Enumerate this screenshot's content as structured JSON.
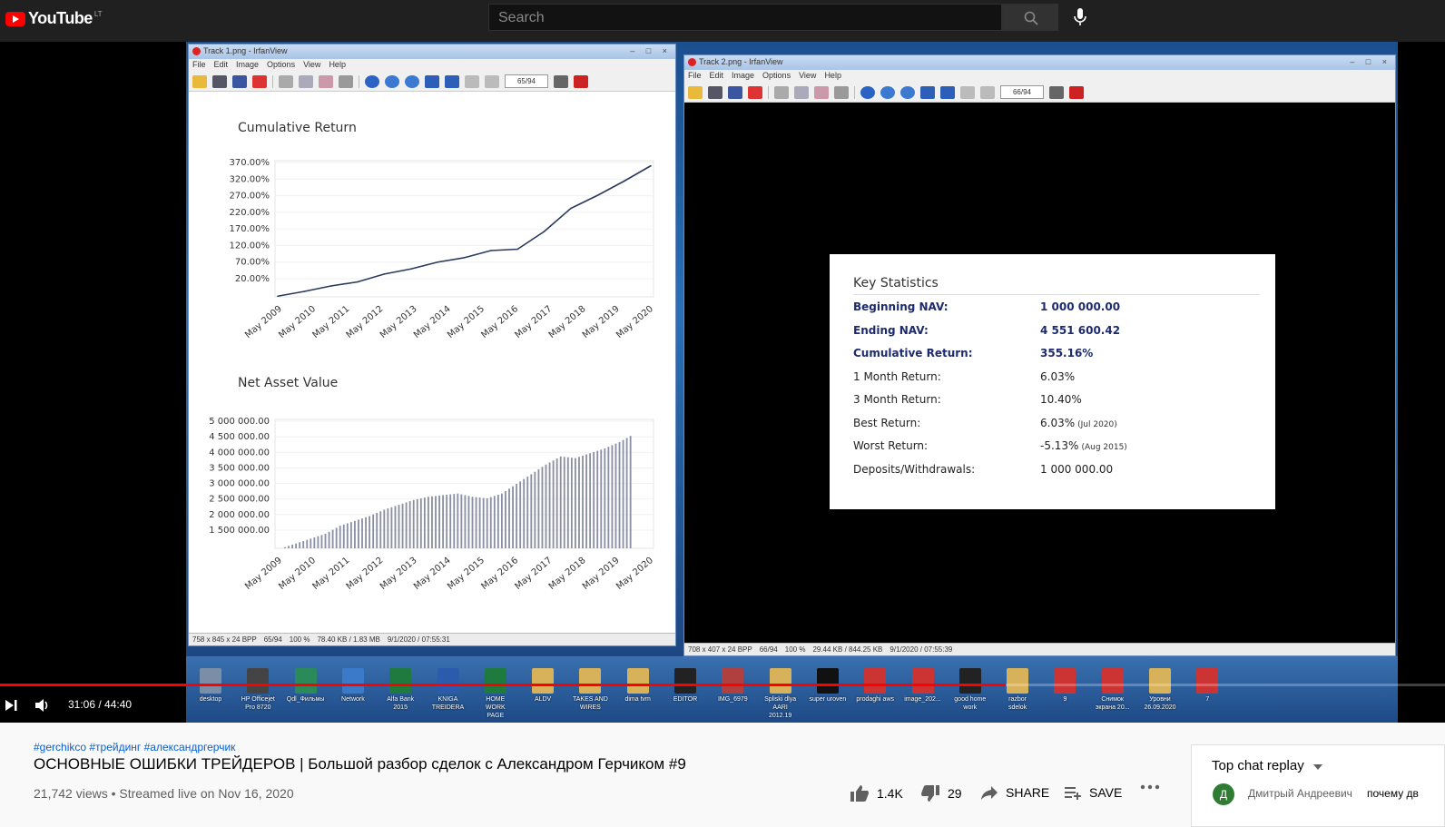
{
  "header": {
    "logo_text": "YouTube",
    "country_code": "LT",
    "search_placeholder": "Search"
  },
  "left_window": {
    "title": "Track 1.png - IrfanView",
    "menu": [
      "File",
      "Edit",
      "Image",
      "Options",
      "View",
      "Help"
    ],
    "page_counter": "65/94",
    "status": [
      "758 x 845 x 24 BPP",
      "65/94",
      "100 %",
      "78.40 KB / 1.83 MB",
      "9/1/2020 / 07:55:31"
    ]
  },
  "right_window": {
    "title": "Track 2.png - IrfanView",
    "menu": [
      "File",
      "Edit",
      "Image",
      "Options",
      "View",
      "Help"
    ],
    "page_counter": "66/94",
    "status": [
      "708 x 407 x 24 BPP",
      "66/94",
      "100 %",
      "29.44 KB / 844.25 KB",
      "9/1/2020 / 07:55:39"
    ]
  },
  "chart_data": [
    {
      "type": "line",
      "title": "Cumulative Return",
      "categories": [
        "May 2009",
        "May 2010",
        "May 2011",
        "May 2012",
        "May 2013",
        "May 2014",
        "May 2015",
        "May 2016",
        "May 2017",
        "May 2018",
        "May 2019",
        "May 2020"
      ],
      "y_tick_labels": [
        "370.00%",
        "320.00%",
        "270.00%",
        "220.00%",
        "170.00%",
        "120.00%",
        "70.00%",
        "20.00%"
      ],
      "ylim": [
        -30,
        370
      ],
      "values": [
        -28,
        -14,
        2,
        14,
        37,
        52,
        72,
        85,
        106,
        110,
        162,
        230,
        268,
        310,
        355
      ],
      "color": "#2b3a5c",
      "grid": true
    },
    {
      "type": "bar",
      "title": "Net Asset Value",
      "categories": [
        "May 2009",
        "May 2010",
        "May 2011",
        "May 2012",
        "May 2013",
        "May 2014",
        "May 2015",
        "May 2016",
        "May 2017",
        "May 2018",
        "May 2019",
        "May 2020"
      ],
      "y_tick_labels": [
        "5 000 000.00",
        "4 500 000.00",
        "4 000 000.00",
        "3 500 000.00",
        "3 000 000.00",
        "2 500 000.00",
        "2 000 000.00",
        "1 500 000.00"
      ],
      "ylim": [
        1000000,
        5000000
      ],
      "values": [
        1000000,
        1150000,
        1300000,
        1450000,
        1700000,
        1850000,
        2000000,
        2200000,
        2350000,
        2500000,
        2600000,
        2650000,
        2700000,
        2600000,
        2550000,
        2700000,
        3000000,
        3300000,
        3600000,
        3850000,
        3800000,
        3950000,
        4100000,
        4300000,
        4550000
      ],
      "color": "#8a8fa3",
      "grid": true
    }
  ],
  "key_stats": {
    "title": "Key Statistics",
    "rows": [
      {
        "label": "Beginning NAV:",
        "value": "1 000 000.00",
        "note": "",
        "bold": true
      },
      {
        "label": "Ending NAV:",
        "value": "4 551 600.42",
        "note": "",
        "bold": true
      },
      {
        "label": "Cumulative Return:",
        "value": "355.16%",
        "note": "",
        "bold": true
      },
      {
        "label": "1 Month Return:",
        "value": "6.03%",
        "note": "",
        "bold": false
      },
      {
        "label": "3 Month Return:",
        "value": "10.40%",
        "note": "",
        "bold": false
      },
      {
        "label": "Best Return:",
        "value": "6.03%",
        "note": "(Jul 2020)",
        "bold": false
      },
      {
        "label": "Worst Return:",
        "value": "-5.13%",
        "note": "(Aug 2015)",
        "bold": false
      },
      {
        "label": "Deposits/Withdrawals:",
        "value": "1 000 000.00",
        "note": "",
        "bold": false
      }
    ]
  },
  "desktop_icons": [
    {
      "label": "desktop",
      "color": "#7a8ea8"
    },
    {
      "label": "HP Officejet Pro 8720",
      "color": "#444"
    },
    {
      "label": "Qdl_Фильмы",
      "color": "#2a8a5a"
    },
    {
      "label": "Network",
      "color": "#3a7ac8"
    },
    {
      "label": "Alfa Bank 2015",
      "color": "#1f7a3f"
    },
    {
      "label": "KNIGA TREIDERA",
      "color": "#2b5bad"
    },
    {
      "label": "HOME WORK PAGE",
      "color": "#1f7a3f"
    },
    {
      "label": "ALDV",
      "color": "#d8b25a"
    },
    {
      "label": "TAKES AND WIRES",
      "color": "#d8b25a"
    },
    {
      "label": "dima tvm",
      "color": "#d8b25a"
    },
    {
      "label": "EDITOR",
      "color": "#222"
    },
    {
      "label": "IMG_6979",
      "color": "#b04040"
    },
    {
      "label": "Spliski dlya AARI 2012.19",
      "color": "#d8b25a"
    },
    {
      "label": "super uroven",
      "color": "#111"
    },
    {
      "label": "prodaghi aws",
      "color": "#c33"
    },
    {
      "label": "image_202...",
      "color": "#c33"
    },
    {
      "label": "good home work",
      "color": "#222"
    },
    {
      "label": "razbor sdelok",
      "color": "#d8b25a"
    },
    {
      "label": "9",
      "color": "#c33"
    },
    {
      "label": "Снимок экрана 20...",
      "color": "#c33"
    },
    {
      "label": "Уровни 26.09.2020",
      "color": "#d8b25a"
    },
    {
      "label": "7",
      "color": "#c33"
    }
  ],
  "player": {
    "time": "31:06 / 44:40",
    "progress": 0.696
  },
  "video_info": {
    "hashtags": "#gerchikco #трейдинг #александргерчик",
    "title": "ОСНОВНЫЕ ОШИБКИ ТРЕЙДЕРОВ | Большой разбор сделок с Александром Герчиком #9",
    "meta": "21,742 views • Streamed live on Nov 16, 2020",
    "likes": "1.4K",
    "dislikes": "29",
    "share": "SHARE",
    "save": "SAVE"
  },
  "chat": {
    "title": "Top chat replay",
    "avatar_letter": "Д",
    "author": "Дмитрый Андреевич",
    "message": "почему дв"
  }
}
